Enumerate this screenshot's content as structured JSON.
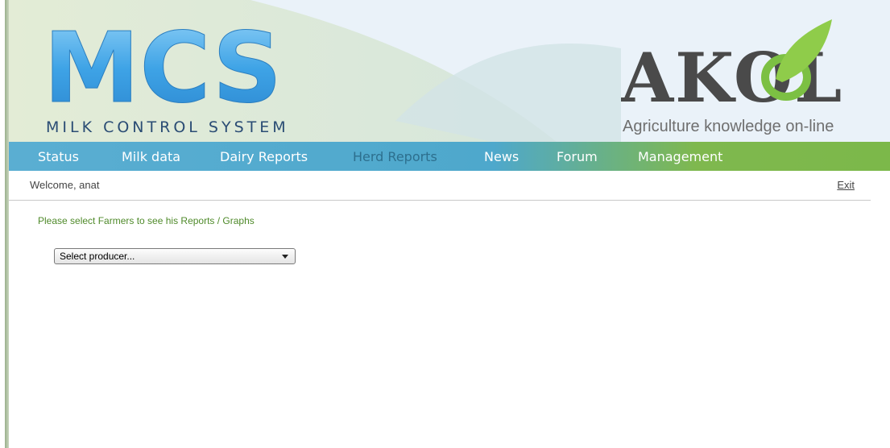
{
  "header": {
    "logo_main": "MCS",
    "logo_sub": "MILK CONTROL SYSTEM",
    "partner_logo": "AKOL",
    "partner_sub": "Agriculture knowledge on-line"
  },
  "nav": {
    "items": [
      {
        "label": "Status"
      },
      {
        "label": "Milk data"
      },
      {
        "label": "Dairy Reports"
      },
      {
        "label": "Herd Reports"
      },
      {
        "label": "News"
      },
      {
        "label": "Forum"
      },
      {
        "label": "Management"
      }
    ],
    "active": "Herd Reports"
  },
  "user": {
    "welcome": "Welcome, anat",
    "exit_label": "Exit"
  },
  "main": {
    "instruction": "Please select Farmers to see his Reports / Graphs",
    "producer_select": {
      "selected": "Select producer..."
    }
  },
  "colors": {
    "nav_blue": "#4ea8cc",
    "nav_green": "#7cb84a",
    "instruction_green": "#4f8a2a",
    "logo_blue": "#3f9ee0"
  }
}
